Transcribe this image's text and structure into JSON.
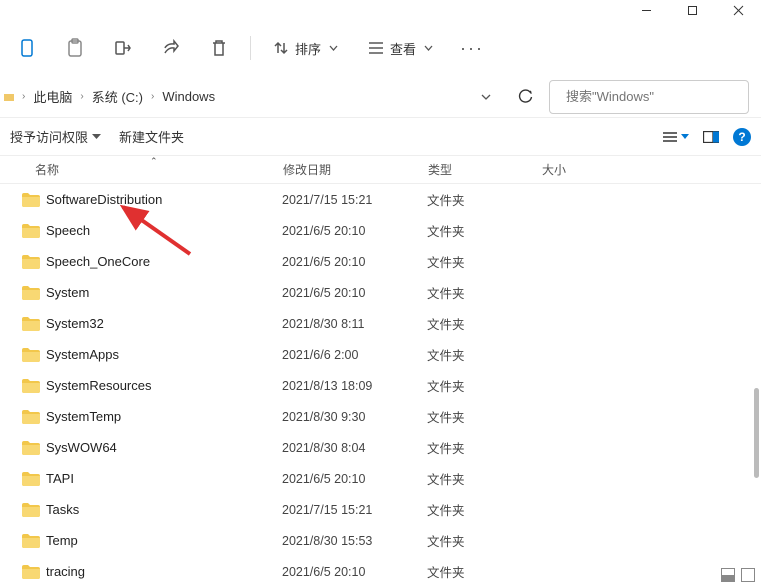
{
  "breadcrumb": {
    "items": [
      "此电脑",
      "系统 (C:)",
      "Windows"
    ]
  },
  "search": {
    "placeholder": "搜索\"Windows\""
  },
  "toolbar": {
    "sort": "排序",
    "view": "查看"
  },
  "sub_toolbar": {
    "permissions": "授予访问权限",
    "new_folder": "新建文件夹"
  },
  "columns": {
    "name": "名称",
    "date": "修改日期",
    "type": "类型",
    "size": "大小"
  },
  "folder_type_label": "文件夹",
  "files": [
    {
      "name": "SoftwareDistribution",
      "date": "2021/7/15 15:21"
    },
    {
      "name": "Speech",
      "date": "2021/6/5 20:10"
    },
    {
      "name": "Speech_OneCore",
      "date": "2021/6/5 20:10"
    },
    {
      "name": "System",
      "date": "2021/6/5 20:10"
    },
    {
      "name": "System32",
      "date": "2021/8/30 8:11"
    },
    {
      "name": "SystemApps",
      "date": "2021/6/6 2:00"
    },
    {
      "name": "SystemResources",
      "date": "2021/8/13 18:09"
    },
    {
      "name": "SystemTemp",
      "date": "2021/8/30 9:30"
    },
    {
      "name": "SysWOW64",
      "date": "2021/8/30 8:04"
    },
    {
      "name": "TAPI",
      "date": "2021/6/5 20:10"
    },
    {
      "name": "Tasks",
      "date": "2021/7/15 15:21"
    },
    {
      "name": "Temp",
      "date": "2021/8/30 15:53"
    },
    {
      "name": "tracing",
      "date": "2021/6/5 20:10"
    }
  ]
}
